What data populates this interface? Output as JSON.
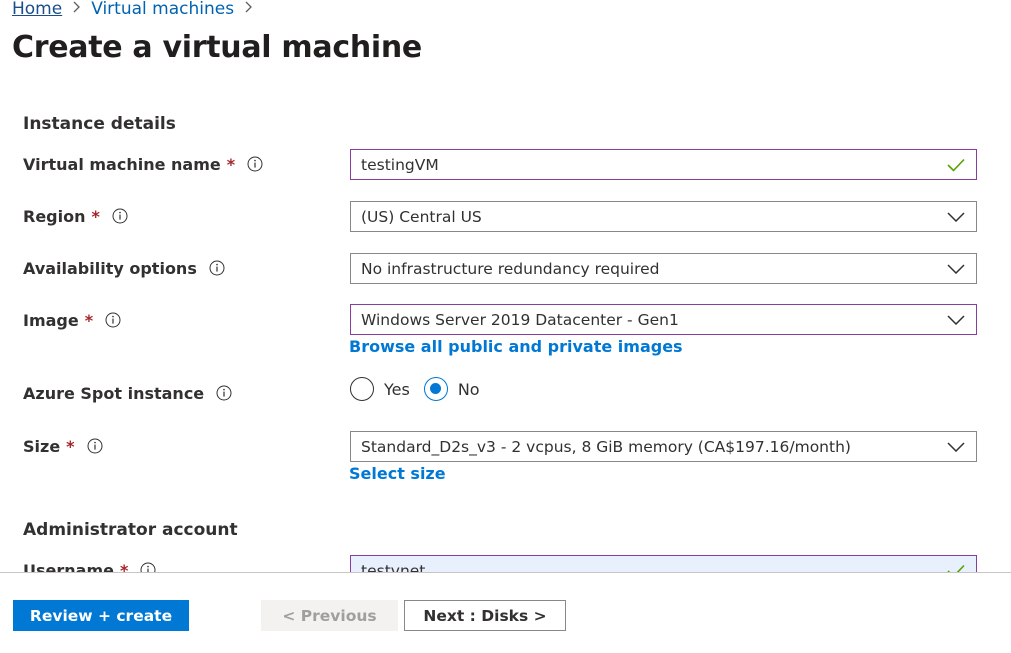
{
  "breadcrumb": {
    "home": "Home",
    "current": "Virtual machines",
    "separator": ">"
  },
  "page_title": "Create a virtual machine",
  "sections": {
    "instance_details": "Instance details",
    "administrator_account": "Administrator account"
  },
  "fields": {
    "vm_name": {
      "label": "Virtual machine name",
      "required": "*",
      "value": "testingVM",
      "status": "valid"
    },
    "region": {
      "label": "Region",
      "required": "*",
      "value": "(US) Central US"
    },
    "availability": {
      "label": "Availability options",
      "value": "No infrastructure redundancy required"
    },
    "image": {
      "label": "Image",
      "required": "*",
      "value": "Windows Server 2019 Datacenter - Gen1",
      "link": "Browse all public and private images"
    },
    "spot": {
      "label": "Azure Spot instance",
      "options": [
        "Yes",
        "No"
      ],
      "selected": "No"
    },
    "size": {
      "label": "Size",
      "required": "*",
      "value": "Standard_D2s_v3 - 2 vcpus, 8 GiB memory (CA$197.16/month)",
      "link": "Select size"
    },
    "username": {
      "label": "Username",
      "required": "*",
      "value": "testvnet",
      "status": "valid"
    }
  },
  "footer": {
    "review_create": "Review + create",
    "previous": "< Previous",
    "next": "Next : Disks >"
  },
  "colors": {
    "accent": "#0078d4",
    "required": "#a4262c",
    "focus_border": "#8a3d9c",
    "valid_check": "#57a300",
    "autofill_bg": "#e8f0fe"
  },
  "icons": {
    "info": "info-icon",
    "check": "checkmark-icon",
    "dropdown": "chevron-down-icon",
    "crumb": "chevron-right-icon"
  }
}
